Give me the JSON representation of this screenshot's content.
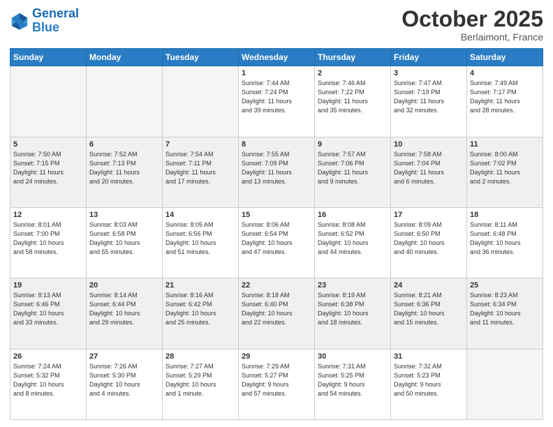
{
  "header": {
    "logo_line1": "General",
    "logo_line2": "Blue",
    "month": "October 2025",
    "location": "Berlaimont, France"
  },
  "days_of_week": [
    "Sunday",
    "Monday",
    "Tuesday",
    "Wednesday",
    "Thursday",
    "Friday",
    "Saturday"
  ],
  "weeks": [
    [
      {
        "num": "",
        "info": ""
      },
      {
        "num": "",
        "info": ""
      },
      {
        "num": "",
        "info": ""
      },
      {
        "num": "1",
        "info": "Sunrise: 7:44 AM\nSunset: 7:24 PM\nDaylight: 11 hours\nand 39 minutes."
      },
      {
        "num": "2",
        "info": "Sunrise: 7:46 AM\nSunset: 7:22 PM\nDaylight: 11 hours\nand 35 minutes."
      },
      {
        "num": "3",
        "info": "Sunrise: 7:47 AM\nSunset: 7:19 PM\nDaylight: 11 hours\nand 32 minutes."
      },
      {
        "num": "4",
        "info": "Sunrise: 7:49 AM\nSunset: 7:17 PM\nDaylight: 11 hours\nand 28 minutes."
      }
    ],
    [
      {
        "num": "5",
        "info": "Sunrise: 7:50 AM\nSunset: 7:15 PM\nDaylight: 11 hours\nand 24 minutes."
      },
      {
        "num": "6",
        "info": "Sunrise: 7:52 AM\nSunset: 7:13 PM\nDaylight: 11 hours\nand 20 minutes."
      },
      {
        "num": "7",
        "info": "Sunrise: 7:54 AM\nSunset: 7:11 PM\nDaylight: 11 hours\nand 17 minutes."
      },
      {
        "num": "8",
        "info": "Sunrise: 7:55 AM\nSunset: 7:09 PM\nDaylight: 11 hours\nand 13 minutes."
      },
      {
        "num": "9",
        "info": "Sunrise: 7:57 AM\nSunset: 7:06 PM\nDaylight: 11 hours\nand 9 minutes."
      },
      {
        "num": "10",
        "info": "Sunrise: 7:58 AM\nSunset: 7:04 PM\nDaylight: 11 hours\nand 6 minutes."
      },
      {
        "num": "11",
        "info": "Sunrise: 8:00 AM\nSunset: 7:02 PM\nDaylight: 11 hours\nand 2 minutes."
      }
    ],
    [
      {
        "num": "12",
        "info": "Sunrise: 8:01 AM\nSunset: 7:00 PM\nDaylight: 10 hours\nand 58 minutes."
      },
      {
        "num": "13",
        "info": "Sunrise: 8:03 AM\nSunset: 6:58 PM\nDaylight: 10 hours\nand 55 minutes."
      },
      {
        "num": "14",
        "info": "Sunrise: 8:05 AM\nSunset: 6:56 PM\nDaylight: 10 hours\nand 51 minutes."
      },
      {
        "num": "15",
        "info": "Sunrise: 8:06 AM\nSunset: 6:54 PM\nDaylight: 10 hours\nand 47 minutes."
      },
      {
        "num": "16",
        "info": "Sunrise: 8:08 AM\nSunset: 6:52 PM\nDaylight: 10 hours\nand 44 minutes."
      },
      {
        "num": "17",
        "info": "Sunrise: 8:09 AM\nSunset: 6:50 PM\nDaylight: 10 hours\nand 40 minutes."
      },
      {
        "num": "18",
        "info": "Sunrise: 8:11 AM\nSunset: 6:48 PM\nDaylight: 10 hours\nand 36 minutes."
      }
    ],
    [
      {
        "num": "19",
        "info": "Sunrise: 8:13 AM\nSunset: 6:46 PM\nDaylight: 10 hours\nand 33 minutes."
      },
      {
        "num": "20",
        "info": "Sunrise: 8:14 AM\nSunset: 6:44 PM\nDaylight: 10 hours\nand 29 minutes."
      },
      {
        "num": "21",
        "info": "Sunrise: 8:16 AM\nSunset: 6:42 PM\nDaylight: 10 hours\nand 25 minutes."
      },
      {
        "num": "22",
        "info": "Sunrise: 8:18 AM\nSunset: 6:40 PM\nDaylight: 10 hours\nand 22 minutes."
      },
      {
        "num": "23",
        "info": "Sunrise: 8:19 AM\nSunset: 6:38 PM\nDaylight: 10 hours\nand 18 minutes."
      },
      {
        "num": "24",
        "info": "Sunrise: 8:21 AM\nSunset: 6:36 PM\nDaylight: 10 hours\nand 15 minutes."
      },
      {
        "num": "25",
        "info": "Sunrise: 8:23 AM\nSunset: 6:34 PM\nDaylight: 10 hours\nand 11 minutes."
      }
    ],
    [
      {
        "num": "26",
        "info": "Sunrise: 7:24 AM\nSunset: 5:32 PM\nDaylight: 10 hours\nand 8 minutes."
      },
      {
        "num": "27",
        "info": "Sunrise: 7:26 AM\nSunset: 5:30 PM\nDaylight: 10 hours\nand 4 minutes."
      },
      {
        "num": "28",
        "info": "Sunrise: 7:27 AM\nSunset: 5:29 PM\nDaylight: 10 hours\nand 1 minute."
      },
      {
        "num": "29",
        "info": "Sunrise: 7:29 AM\nSunset: 5:27 PM\nDaylight: 9 hours\nand 57 minutes."
      },
      {
        "num": "30",
        "info": "Sunrise: 7:31 AM\nSunset: 5:25 PM\nDaylight: 9 hours\nand 54 minutes."
      },
      {
        "num": "31",
        "info": "Sunrise: 7:32 AM\nSunset: 5:23 PM\nDaylight: 9 hours\nand 50 minutes."
      },
      {
        "num": "",
        "info": ""
      }
    ]
  ]
}
